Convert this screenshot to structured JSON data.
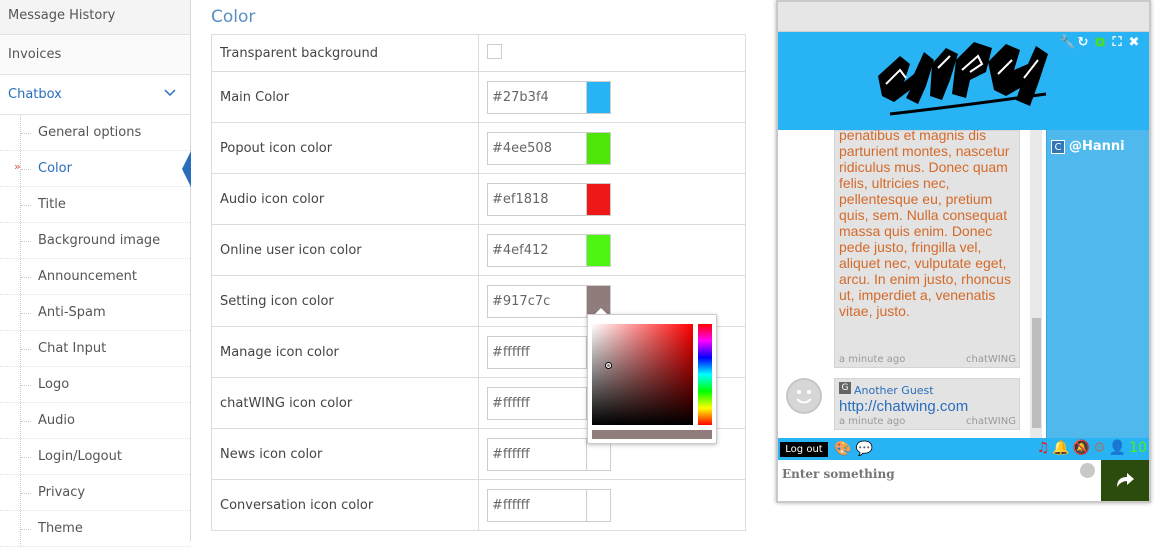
{
  "sidebar": {
    "top_items": [
      "Message History",
      "Invoices"
    ],
    "section": "Chatbox",
    "sub_items": [
      {
        "label": "General options",
        "active": false
      },
      {
        "label": "Color",
        "active": true
      },
      {
        "label": "Title",
        "active": false
      },
      {
        "label": "Background image",
        "active": false
      },
      {
        "label": "Announcement",
        "active": false
      },
      {
        "label": "Anti-Spam",
        "active": false
      },
      {
        "label": "Chat Input",
        "active": false
      },
      {
        "label": "Logo",
        "active": false
      },
      {
        "label": "Audio",
        "active": false
      },
      {
        "label": "Login/Logout",
        "active": false
      },
      {
        "label": "Privacy",
        "active": false
      },
      {
        "label": "Theme",
        "active": false
      }
    ]
  },
  "main": {
    "title": "Color",
    "transparent_label": "Transparent background",
    "rows": [
      {
        "label": "Main Color",
        "value": "#27b3f4",
        "swatch": "#27b3f4"
      },
      {
        "label": "Popout icon color",
        "value": "#4ee508",
        "swatch": "#4ee508"
      },
      {
        "label": "Audio icon color",
        "value": "#ef1818",
        "swatch": "#ef1818"
      },
      {
        "label": "Online user icon color",
        "value": "#4ef412",
        "swatch": "#4ef412"
      },
      {
        "label": "Setting icon color",
        "value": "#917c7c",
        "swatch": "#917c7c"
      },
      {
        "label": "Manage icon color",
        "value": "#ffffff",
        "swatch": "#ffffff"
      },
      {
        "label": "chatWING icon color",
        "value": "#ffffff",
        "swatch": "#ffffff"
      },
      {
        "label": "News icon color",
        "value": "#ffffff",
        "swatch": "#ffffff"
      },
      {
        "label": "Conversation icon color",
        "value": "#ffffff",
        "swatch": "#ffffff"
      }
    ]
  },
  "picker": {
    "preview_color": "#917c7c"
  },
  "chat": {
    "main_color": "#27b3f4",
    "message1": {
      "text": "penatibus et magnis dis parturient montes, nascetur ridiculus mus. Donec quam felis, ultricies nec, pellentesque eu, pretium quis, sem. Nulla consequat massa quis enim. Donec pede justo, fringilla vel, aliquet nec, vulputate eget, arcu. In enim justo, rhoncus ut, imperdiet a, venenatis vitae, justo.",
      "time": "a minute ago",
      "brand_a": "chat",
      "brand_b": "WING"
    },
    "message2": {
      "badge": "G",
      "author": "Another Guest",
      "text": "http://chatwing.com",
      "time": "a minute ago",
      "brand_a": "chat",
      "brand_b": "WING"
    },
    "user": {
      "badge": "C",
      "name": "@Hanni"
    },
    "logout_label": "Log out",
    "online_count": "10",
    "input_placeholder": "Enter something"
  }
}
